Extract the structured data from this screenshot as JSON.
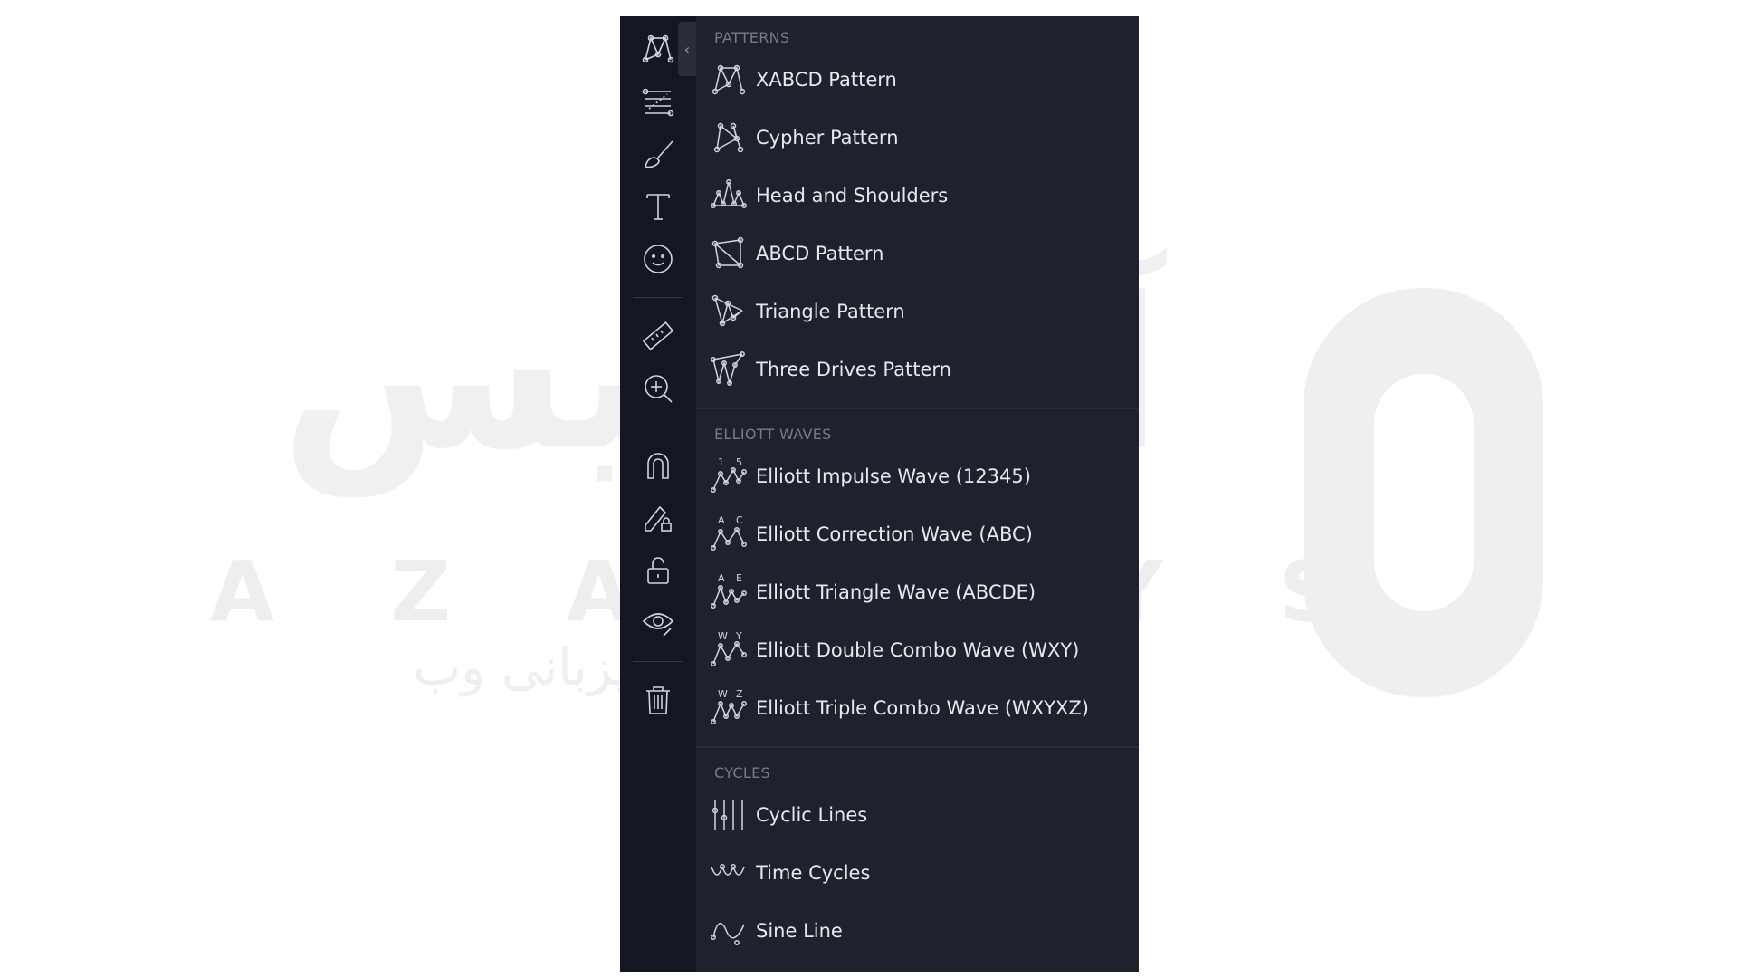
{
  "watermark": {
    "latin": "AZARSYS",
    "persian_main": "آذرسیس",
    "persian_sub": "سرعت بی نهایت میزبانی وب"
  },
  "toolbar": {
    "tools": [
      {
        "icon": "xabcd-pattern-icon"
      },
      {
        "icon": "fib-retracement-icon"
      },
      {
        "icon": "brush-icon"
      },
      {
        "icon": "text-icon"
      },
      {
        "icon": "emoji-icon"
      },
      {
        "icon": "ruler-icon"
      },
      {
        "icon": "zoom-in-icon"
      },
      {
        "icon": "magnet-icon"
      },
      {
        "icon": "lock-drawing-icon"
      },
      {
        "icon": "unlock-icon"
      },
      {
        "icon": "eye-icon"
      },
      {
        "icon": "trash-icon"
      }
    ],
    "collapse_glyph": "‹"
  },
  "menu": {
    "patterns": {
      "title": "PATTERNS",
      "items": [
        {
          "label": "XABCD Pattern",
          "icon": "xabcd-icon"
        },
        {
          "label": "Cypher Pattern",
          "icon": "cypher-icon"
        },
        {
          "label": "Head and Shoulders",
          "icon": "head-shoulders-icon"
        },
        {
          "label": "ABCD Pattern",
          "icon": "abcd-icon"
        },
        {
          "label": "Triangle Pattern",
          "icon": "triangle-pattern-icon"
        },
        {
          "label": "Three Drives Pattern",
          "icon": "three-drives-icon"
        }
      ]
    },
    "elliott": {
      "title": "ELLIOTT WAVES",
      "items": [
        {
          "label": "Elliott Impulse Wave (12345)",
          "icon": "elliott-impulse-icon",
          "tags": [
            "1",
            "5"
          ]
        },
        {
          "label": "Elliott Correction Wave (ABC)",
          "icon": "elliott-correction-icon",
          "tags": [
            "A",
            "C"
          ]
        },
        {
          "label": "Elliott Triangle Wave (ABCDE)",
          "icon": "elliott-triangle-icon",
          "tags": [
            "A",
            "E"
          ]
        },
        {
          "label": "Elliott Double Combo Wave (WXY)",
          "icon": "elliott-double-combo-icon",
          "tags": [
            "W",
            "Y"
          ]
        },
        {
          "label": "Elliott Triple Combo Wave (WXYXZ)",
          "icon": "elliott-triple-combo-icon",
          "tags": [
            "W",
            "Z"
          ]
        }
      ]
    },
    "cycles": {
      "title": "CYCLES",
      "items": [
        {
          "label": "Cyclic Lines",
          "icon": "cyclic-lines-icon"
        },
        {
          "label": "Time Cycles",
          "icon": "time-cycles-icon"
        },
        {
          "label": "Sine Line",
          "icon": "sine-line-icon"
        }
      ]
    }
  }
}
